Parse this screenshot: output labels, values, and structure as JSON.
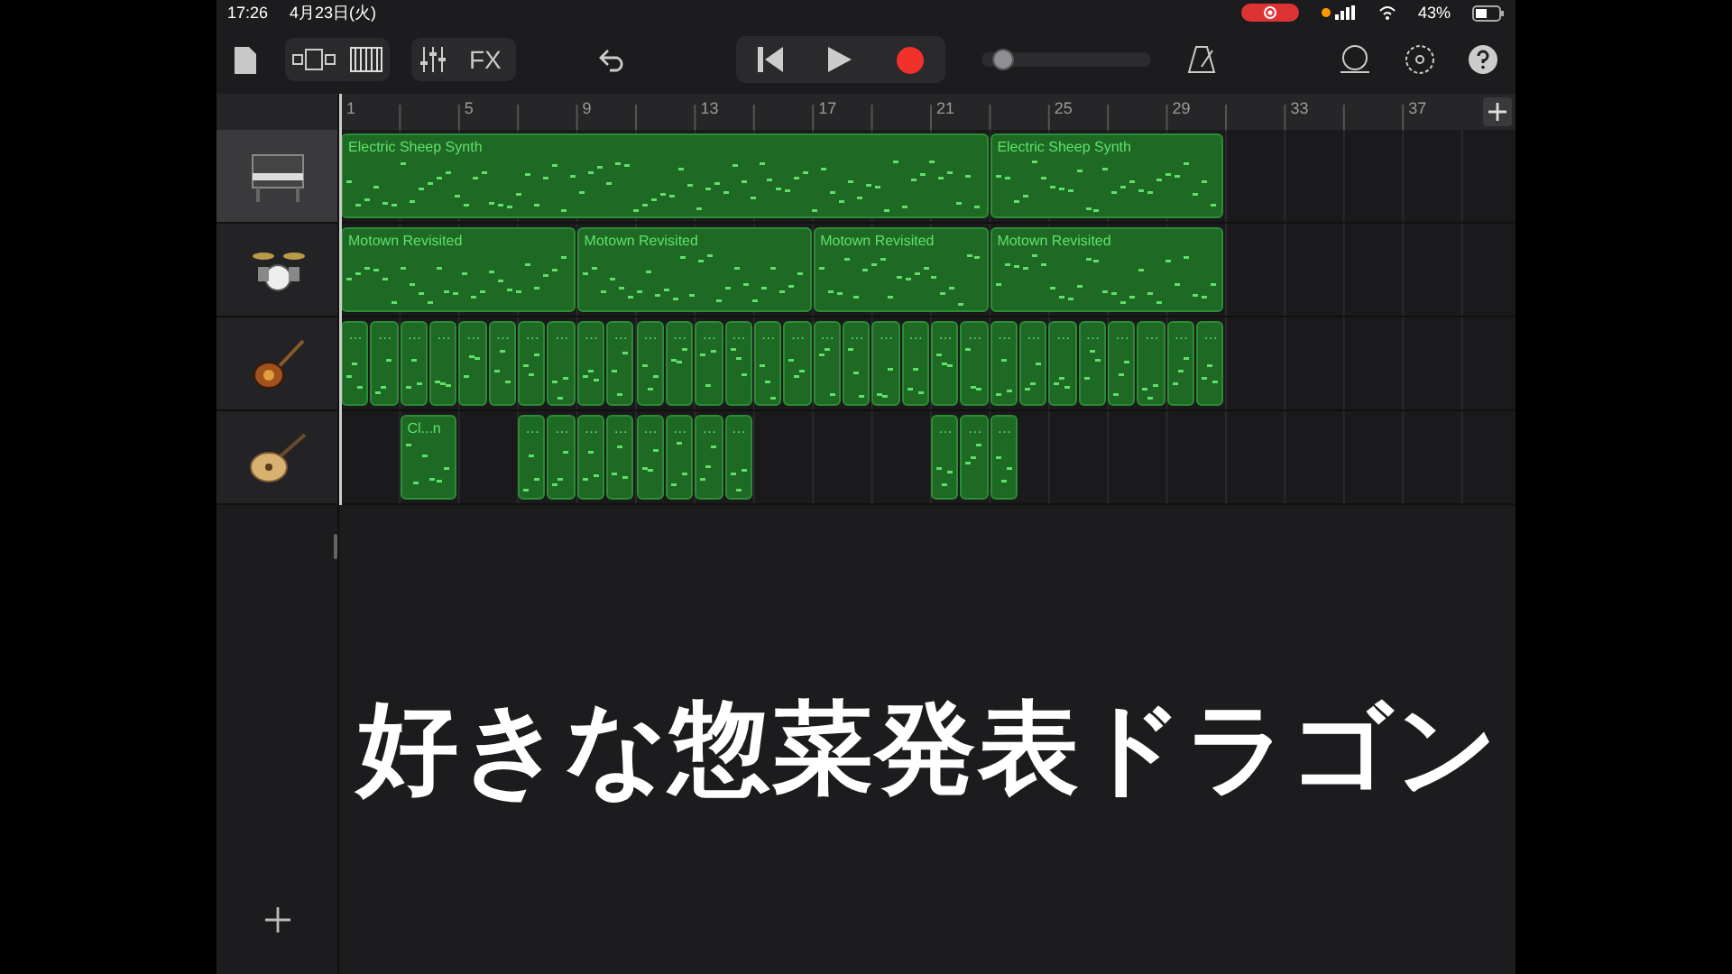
{
  "status_bar": {
    "time": "17:26",
    "date": "4月23日(火)",
    "battery": "43%"
  },
  "toolbar": {
    "fx": "FX",
    "master_volume": {
      "level": 0.08
    }
  },
  "ruler": {
    "bars": [
      "1",
      "5",
      "9",
      "13",
      "17",
      "21",
      "25",
      "29",
      "33",
      "37"
    ]
  },
  "tracks": [
    {
      "kind": "piano",
      "selected": true,
      "regions": [
        {
          "title": "Electric Sheep Synth"
        },
        {
          "title": "Electric Sheep Synth"
        }
      ]
    },
    {
      "kind": "drums",
      "selected": false,
      "regions": [
        {
          "title": "Motown Revisited"
        },
        {
          "title": "Motown Revisited"
        },
        {
          "title": "Motown Revisited"
        },
        {
          "title": "Motown Revisited"
        }
      ]
    },
    {
      "kind": "bass",
      "selected": false,
      "regions": [
        {
          "title": "…"
        },
        {
          "title": "…"
        },
        {
          "title": "…"
        },
        {
          "title": "…"
        },
        {
          "title": "…"
        },
        {
          "title": "…"
        },
        {
          "title": "…"
        },
        {
          "title": "…"
        },
        {
          "title": "…"
        },
        {
          "title": "…"
        },
        {
          "title": "…"
        },
        {
          "title": "…"
        },
        {
          "title": "…"
        },
        {
          "title": "…"
        },
        {
          "title": "…"
        },
        {
          "title": "…"
        },
        {
          "title": "…"
        },
        {
          "title": "…"
        },
        {
          "title": "…"
        },
        {
          "title": "…"
        },
        {
          "title": "…"
        },
        {
          "title": "…"
        },
        {
          "title": "…"
        },
        {
          "title": "…"
        },
        {
          "title": "…"
        },
        {
          "title": "…"
        },
        {
          "title": "…"
        },
        {
          "title": "…"
        },
        {
          "title": "…"
        },
        {
          "title": "…"
        }
      ]
    },
    {
      "kind": "guitar",
      "selected": false,
      "regions": [
        {
          "title": "Cl...n"
        },
        {
          "title": "…"
        },
        {
          "title": "…"
        },
        {
          "title": "…"
        },
        {
          "title": "…"
        },
        {
          "title": "…"
        },
        {
          "title": "…"
        },
        {
          "title": "…"
        },
        {
          "title": "…"
        },
        {
          "title": "…"
        },
        {
          "title": "…"
        },
        {
          "title": "…"
        }
      ]
    }
  ],
  "caption": "好きな惣菜発表ドラゴン"
}
